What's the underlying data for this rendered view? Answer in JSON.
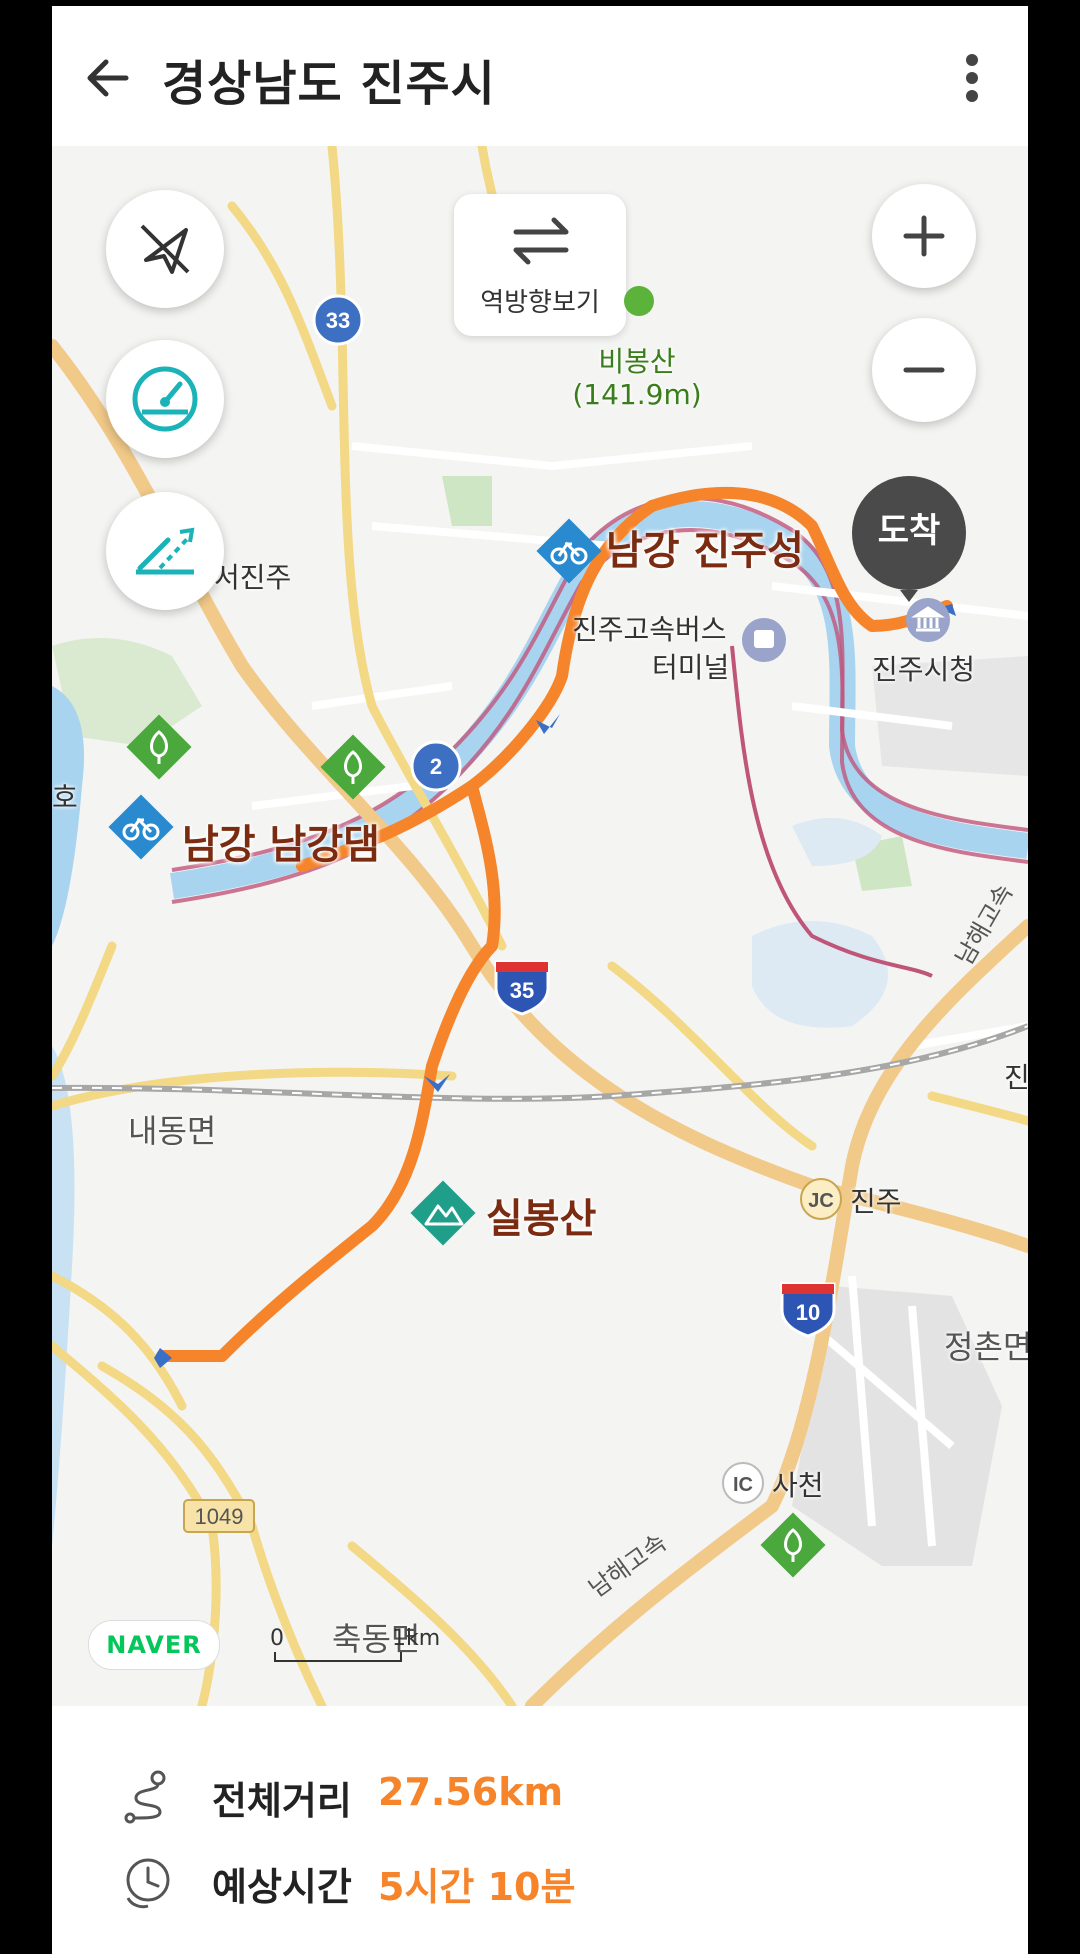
{
  "header": {
    "title": "경상남도 진주시",
    "back_icon": "arrow-left-icon",
    "more_icon": "more-vertical-icon"
  },
  "map": {
    "reverse_label": "역방향보기",
    "destination_label": "도착",
    "pois": {
      "nangang_jinjuseong": "남강 진주성",
      "nangang_dam": "남강 남강댐",
      "silbongsan": "실봉산",
      "bibongsan": "비봉산",
      "bibongsan_height": "(141.9m)",
      "bus_terminal_1": "진주고속버스",
      "bus_terminal_2": "터미널",
      "city_hall": "진주시청",
      "seojinju": "서진주",
      "naedong": "내동면",
      "jeongchon": "정촌면",
      "chukdong": "축동면",
      "jinju_jc": "진주",
      "sacheon_ic": "사천",
      "ho": "호",
      "jin_edge": "진",
      "namhae_1": "남해고속",
      "namhae_2": "남해고속"
    },
    "road_badges": {
      "r33": "33",
      "r2": "2",
      "r35": "35",
      "r10": "10",
      "r1049": "1049",
      "jc": "JC",
      "ic": "IC"
    },
    "brand": "NAVER",
    "scale_start": "0",
    "scale_end": "1km",
    "route_color": "#f5842b",
    "river_color": "#a8d4f0"
  },
  "summary": {
    "distance_label": "전체거리",
    "distance_value": "27.56km",
    "time_label": "예상시간",
    "time_value": "5시간 10분"
  }
}
